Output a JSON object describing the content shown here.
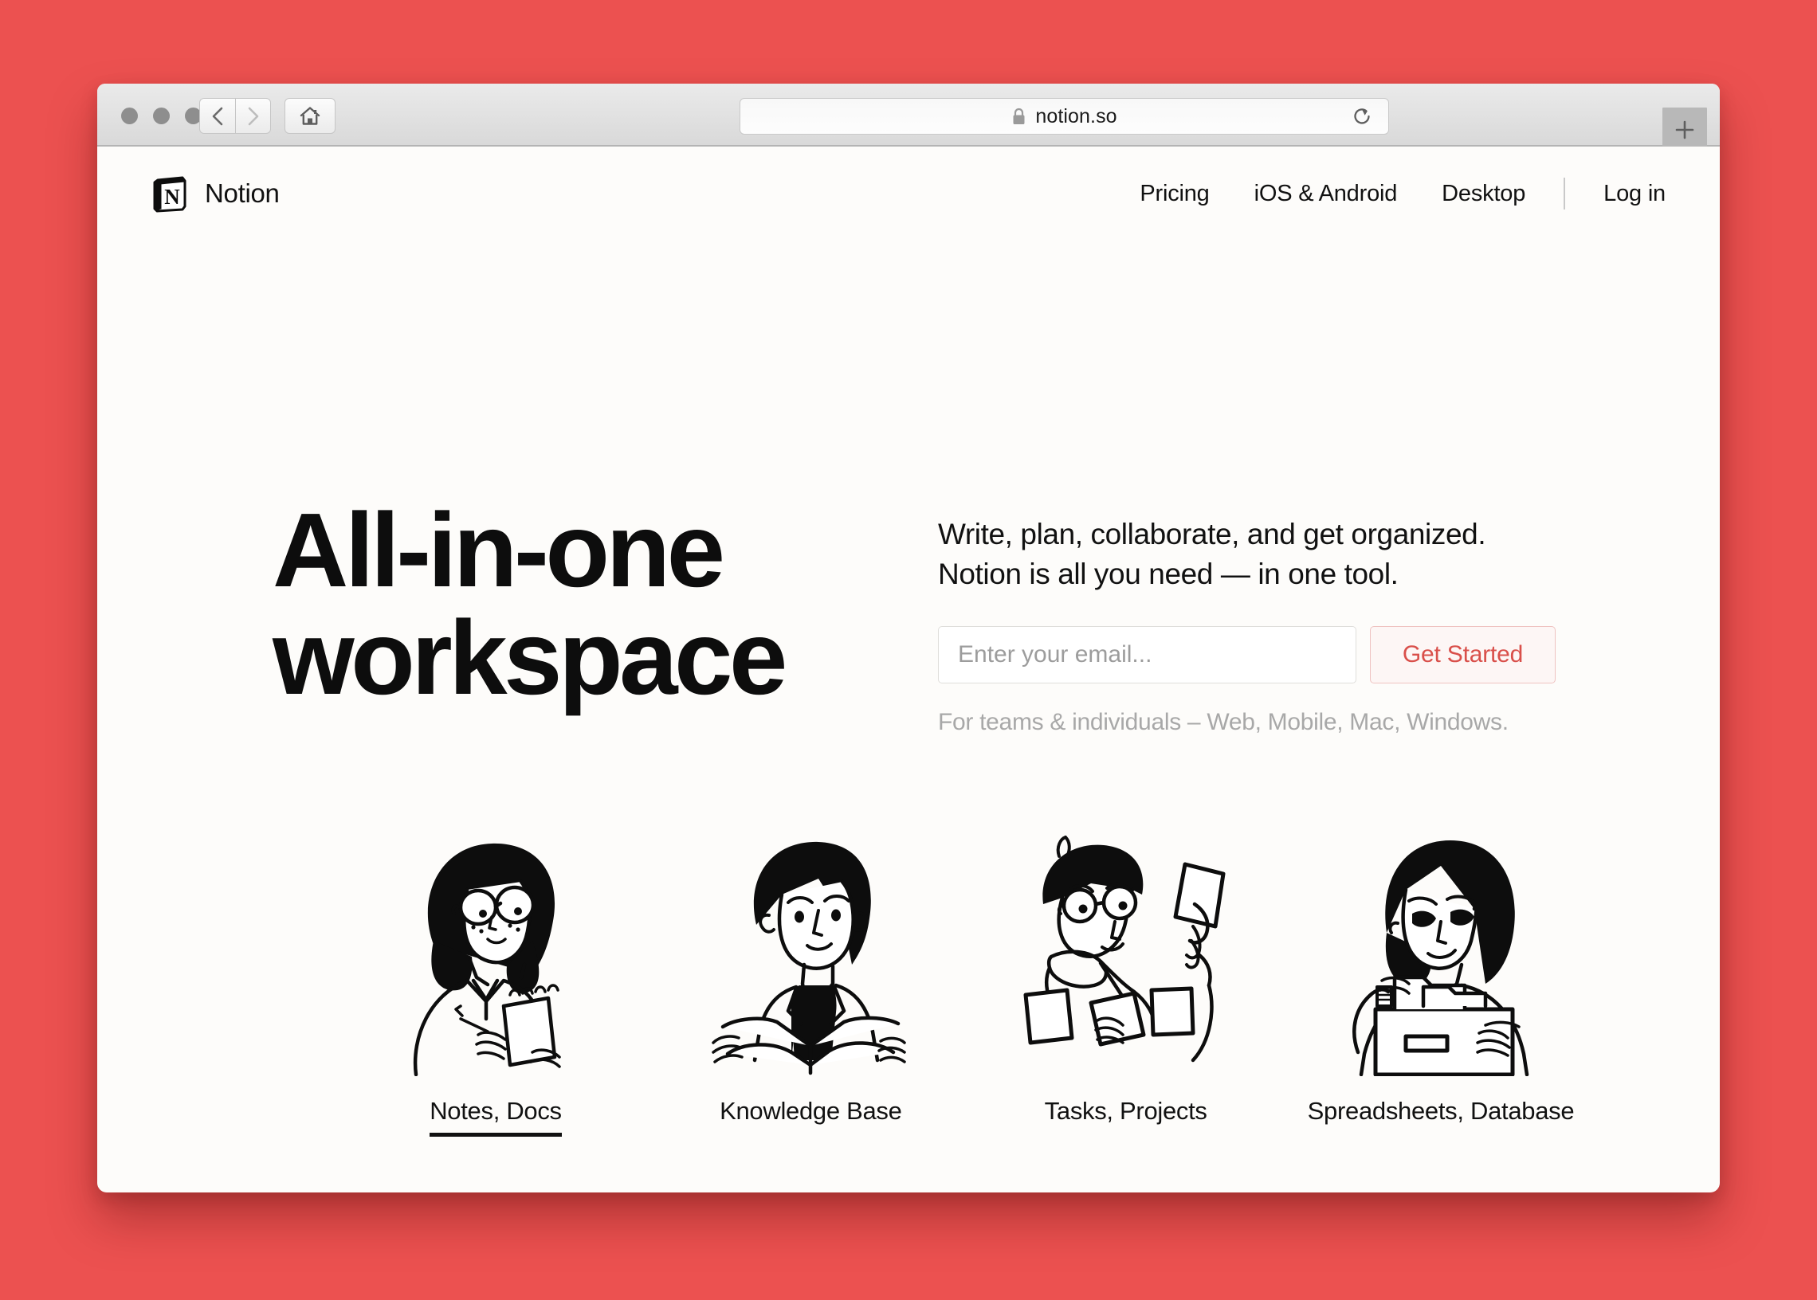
{
  "theme": {
    "background_color": "#ec5150",
    "page_background": "#fdfcfa",
    "accent_color": "#d94f4a",
    "text_color": "#111111",
    "muted_text_color": "#a8a8a8"
  },
  "browser": {
    "traffic_lights": [
      "close",
      "minimize",
      "maximize"
    ],
    "back_icon": "chevron-left-icon",
    "forward_icon": "chevron-right-icon",
    "home_icon": "home-icon",
    "lock_icon": "lock-icon",
    "url": "notion.so",
    "reload_icon": "reload-icon",
    "new_tab_label": "+"
  },
  "site": {
    "brand": {
      "logo_icon": "notion-cube-logo-icon",
      "name": "Notion"
    },
    "nav": [
      {
        "label": "Pricing"
      },
      {
        "label": "iOS & Android"
      },
      {
        "label": "Desktop"
      }
    ],
    "login_label": "Log in"
  },
  "hero": {
    "headline_line_1": "All-in-one",
    "headline_line_2": "workspace",
    "subhead_line_1": "Write, plan, collaborate, and get organized.",
    "subhead_line_2": "Notion is all you need — in one tool.",
    "email_placeholder": "Enter your email...",
    "email_value": "",
    "cta_label": "Get Started",
    "fineprint": "For teams & individuals – Web, Mobile, Mac, Windows."
  },
  "features": [
    {
      "label": "Notes, Docs",
      "illustration": "woman-writing-notepad-illustration",
      "active": true
    },
    {
      "label": "Knowledge Base",
      "illustration": "man-reading-book-illustration",
      "active": false
    },
    {
      "label": "Tasks, Projects",
      "illustration": "man-holding-cards-illustration",
      "active": false
    },
    {
      "label": "Spreadsheets, Database",
      "illustration": "woman-file-drawer-illustration",
      "active": false
    }
  ]
}
